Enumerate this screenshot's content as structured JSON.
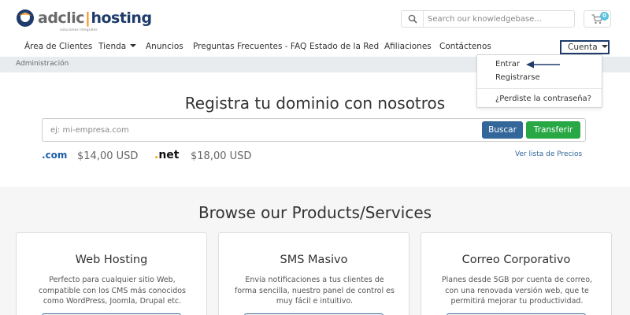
{
  "header": {
    "brand_part1": "adclic",
    "brand_separator": "|",
    "brand_part2": "hosting",
    "brand_tagline": "soluciones integrales",
    "search_placeholder": "Search our knowledgebase...",
    "cart_count": "0"
  },
  "nav": {
    "items": [
      "Área de Clientes",
      "Tienda",
      "Anuncios",
      "Preguntas Frecuentes - FAQ",
      "Estado de la Red",
      "Afiliaciones",
      "Contáctenos"
    ],
    "account_label": "Cuenta"
  },
  "breadcrumb": "Administración",
  "account_menu": {
    "items": [
      "Entrar",
      "Registrarse",
      "¿Perdiste la contraseña?"
    ]
  },
  "domain": {
    "title": "Registra tu dominio con nosotros",
    "placeholder": "ej: mi-empresa.com",
    "search_button": "Buscar",
    "transfer_button": "Transferir",
    "tlds": [
      {
        "dot": ".",
        "name": "com",
        "price": "$14,00 USD"
      },
      {
        "dot": ".",
        "name": "net",
        "price": "$18,00 USD"
      }
    ],
    "price_list_link": "Ver lista de Precios"
  },
  "products": {
    "title": "Browse our Products/Services",
    "cards": [
      {
        "title": "Web Hosting",
        "description": "Perfecto para cualquier sitio Web, compatible con los CMS más conocidos como WordPress, Joomla, Drupal etc."
      },
      {
        "title": "SMS Masivo",
        "description": "Envía notificaciones a tus clientes de forma sencilla, nuestro panel de control es muy fácil e intuitivo."
      },
      {
        "title": "Correo Corporativo",
        "description": "Planes desde 5GB por cuenta de correo, con una renovada versión web, que te permitirá mejorar tu productividad."
      }
    ]
  },
  "colors": {
    "brand_navy": "#1f3b6b",
    "brand_orange": "#f7931e",
    "primary_button": "#336699",
    "success_button": "#28a745",
    "badge": "#5bc0de"
  }
}
